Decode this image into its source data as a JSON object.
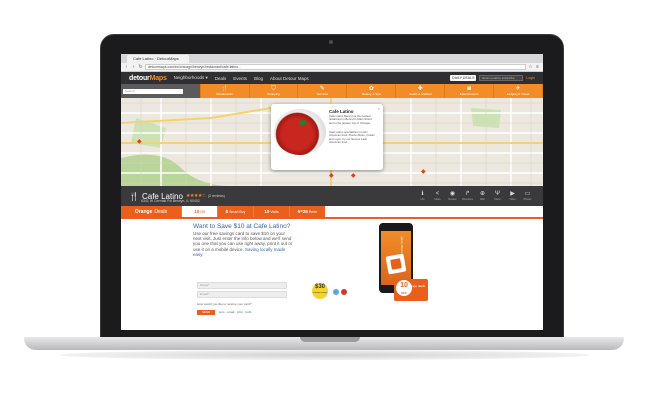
{
  "browser": {
    "tab_title": "Cafe Latino · DetourMaps",
    "url": "detourmaps.com/en/chicago/berwyn/restaurant/cafe-latino..."
  },
  "site": {
    "logo_main": "detour",
    "logo_accent": "Maps",
    "nav": [
      "Neighborhoods ▾",
      "Deals",
      "Events",
      "Blog",
      "About Detour Maps"
    ],
    "deals_button": "DAILY DEALS",
    "signin_placeholder": "Enter email to subscribe",
    "login": "Login"
  },
  "categories": {
    "search_placeholder": "Search",
    "items": [
      {
        "label": "Restaurants",
        "icon": "fork-icon"
      },
      {
        "label": "Shopping",
        "icon": "bag-icon"
      },
      {
        "label": "Services",
        "icon": "wrench-icon"
      },
      {
        "label": "Beauty & Spa",
        "icon": "lotus-icon"
      },
      {
        "label": "Health & Medical",
        "icon": "cross-icon"
      },
      {
        "label": "Entertainment",
        "icon": "camera-icon"
      },
      {
        "label": "Lodging & Travel",
        "icon": "plane-icon"
      }
    ]
  },
  "map": {
    "popup_title": "Cafe Latino",
    "popup_desc": "Cafe Latino Berwyn is the coolest restaurant in Berwyn's Main Street and in the greater city of Chicago.",
    "popup_desc2": "Cafe Latino specializes in Latin American food: Puerto Rican, Cuban and more; try our famous Latin American food...",
    "close": "×"
  },
  "business": {
    "name": "Cafe Latino",
    "stars": "★★★★☆",
    "reviews": "(3 reviews)",
    "address": "6341 W Cermak Rd Berwyn, IL 60402",
    "tools": [
      {
        "icon": "info-icon",
        "glyph": "ℹ",
        "label": "Info"
      },
      {
        "icon": "share-icon",
        "glyph": "<",
        "label": "Share"
      },
      {
        "icon": "eye-icon",
        "glyph": "◉",
        "label": "Review"
      },
      {
        "icon": "route-icon",
        "glyph": "↱",
        "label": "Directions"
      },
      {
        "icon": "globe-icon",
        "glyph": "⊕",
        "label": "Web"
      },
      {
        "icon": "menu-icon",
        "glyph": "Ψ",
        "label": "Menu"
      },
      {
        "icon": "video-icon",
        "glyph": "▶",
        "label": "Video"
      },
      {
        "icon": "photo-icon",
        "glyph": "▭",
        "label": "Photos"
      }
    ]
  },
  "deals": {
    "brand_bold": "Orange",
    "brand_light": "Deals",
    "tabs": [
      {
        "num": "10",
        "label": "Off"
      },
      {
        "num": "$",
        "label": "Smart Buy"
      },
      {
        "num": "10",
        "label": "Visits"
      },
      {
        "num": "5=25",
        "label": "Refer"
      }
    ]
  },
  "promo": {
    "title": "Want to Save $10 at Cafe Latino?",
    "text": "Use our free savings card to save $10 on your next visit. Just enter the info below and we'll send you one that you can use right away, print it out or use it on a mobile device.",
    "link": "Saving locally made easy.",
    "name_placeholder": "Name*",
    "email_placeholder": "Email*",
    "radio_label": "How would you like to receive your card?",
    "send_button": "SEND",
    "options": "sms · email · print · both",
    "badge30_value": "$30",
    "badge30_text": "average savings",
    "phone_brand": "orange deals",
    "card_value": "10",
    "card_off": "OFF",
    "card_brand": "orange deals"
  }
}
